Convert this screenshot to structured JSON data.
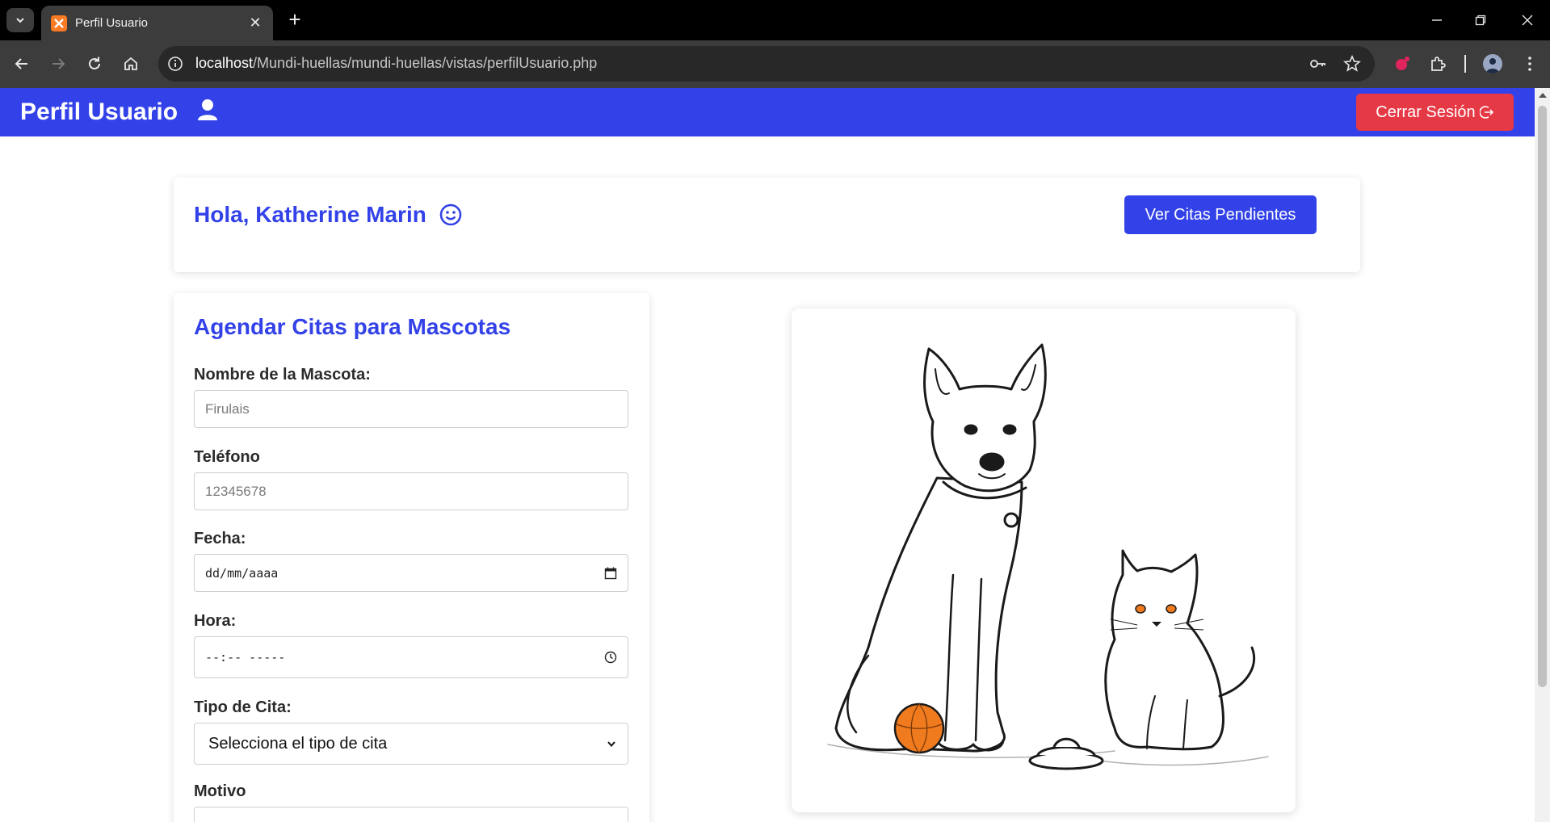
{
  "browser": {
    "tab_title": "Perfil Usuario",
    "url_host": "localhost",
    "url_path": "/Mundi-huellas/mundi-huellas/vistas/perfilUsuario.php"
  },
  "navbar": {
    "title": "Perfil Usuario",
    "logout_label": "Cerrar Sesión"
  },
  "greeting": {
    "text": "Hola, Katherine Marin",
    "appointments_button": "Ver Citas Pendientes"
  },
  "form": {
    "title": "Agendar Citas para Mascotas",
    "pet_name_label": "Nombre de la Mascota:",
    "pet_name_placeholder": "Firulais",
    "phone_label": "Teléfono",
    "phone_placeholder": "12345678",
    "date_label": "Fecha:",
    "date_value": "dd/mm/aaaa",
    "time_label": "Hora:",
    "time_value": "--:-- -----",
    "type_label": "Tipo de Cita:",
    "type_selected": "Selecciona el tipo de cita",
    "reason_label": "Motivo"
  },
  "colors": {
    "primary": "#3342e8",
    "danger": "#e63946",
    "ball": "#f07a1e"
  },
  "icons": [
    "user-icon",
    "logout-icon",
    "smile-icon",
    "calendar-icon",
    "clock-icon",
    "chevron-down-icon"
  ]
}
